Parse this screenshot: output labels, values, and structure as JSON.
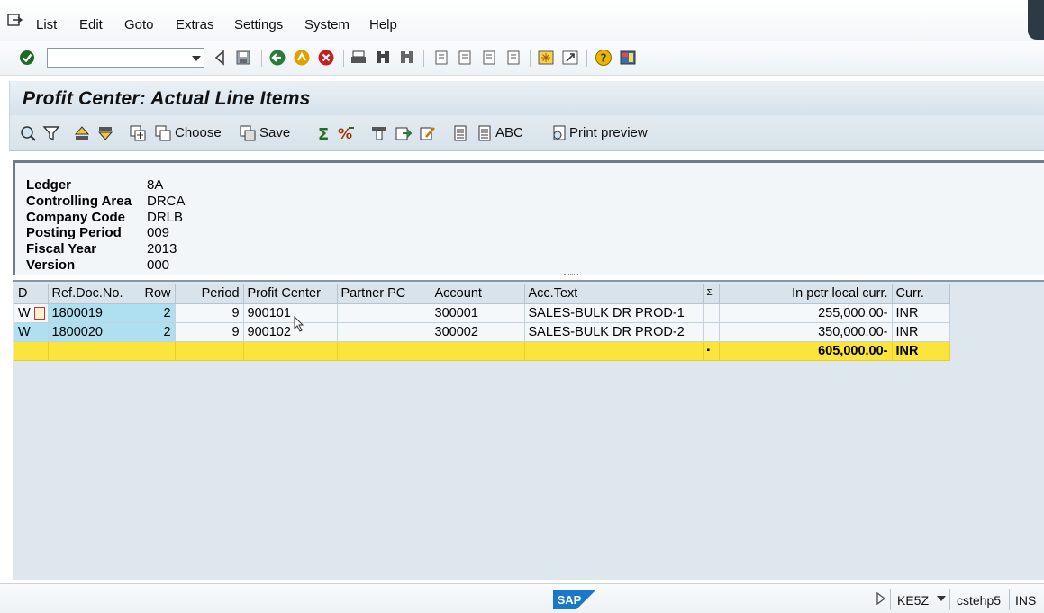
{
  "menu": [
    "List",
    "Edit",
    "Goto",
    "Extras",
    "Settings",
    "System",
    "Help"
  ],
  "title": "Profit Center: Actual Line Items",
  "app_toolbar": {
    "choose_label": "Choose",
    "save_label": "Save",
    "abc_label": "ABC",
    "print_preview_label": "Print preview"
  },
  "header": [
    {
      "label": "Ledger",
      "value": "8A"
    },
    {
      "label": "Controlling Area",
      "value": "DRCA"
    },
    {
      "label": "Company Code",
      "value": "DRLB"
    },
    {
      "label": "Posting Period",
      "value": "009"
    },
    {
      "label": "Fiscal Year",
      "value": "2013"
    },
    {
      "label": "Version",
      "value": "000"
    }
  ],
  "grid": {
    "columns": [
      "D",
      "Ref.Doc.No.",
      "Row",
      "Period",
      "Profit Center",
      "Partner PC",
      "Account",
      "Acc.Text",
      "Σ",
      "In pctr local curr.",
      "Curr."
    ],
    "rows": [
      {
        "d": "W",
        "ref_doc": "1800019",
        "row": "2",
        "period": "9",
        "profit_center": "900101",
        "partner_pc": "",
        "account": "300001",
        "acc_text": "SALES-BULK DR PROD-1",
        "sigma": "",
        "amount": "255,000.00-",
        "curr": "INR"
      },
      {
        "d": "W",
        "ref_doc": "1800020",
        "row": "2",
        "period": "9",
        "profit_center": "900102",
        "partner_pc": "",
        "account": "300002",
        "acc_text": "SALES-BULK DR PROD-2",
        "sigma": "",
        "amount": "350,000.00-",
        "curr": "INR"
      }
    ],
    "total": {
      "sigma": "▪",
      "amount": "605,000.00-",
      "curr": "INR"
    }
  },
  "status": {
    "logo": "SAP",
    "transaction": "KE5Z",
    "server": "cstehp5",
    "mode": "INS"
  },
  "colors": {
    "key_cell": "#aee0f2",
    "total_row": "#fbe53d",
    "title_bg": "#d5e2ec"
  }
}
